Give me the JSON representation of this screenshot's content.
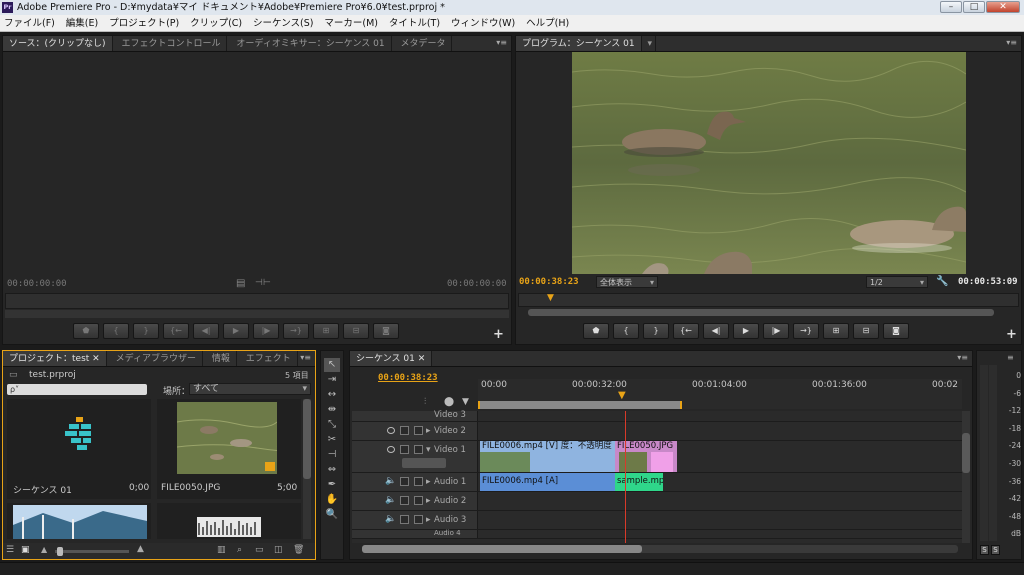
{
  "window": {
    "title": "Adobe Premiere Pro - D:¥mydata¥マイ ドキュメント¥Adobe¥Premiere Pro¥6.0¥test.prproj *",
    "app_badge": "Pr"
  },
  "menu": [
    "ファイル(F)",
    "編集(E)",
    "プロジェクト(P)",
    "クリップ(C)",
    "シーケンス(S)",
    "マーカー(M)",
    "タイトル(T)",
    "ウィンドウ(W)",
    "ヘルプ(H)"
  ],
  "source_panel": {
    "tabs": [
      "ソース：(クリップなし)",
      "エフェクトコントロール",
      "オーディオミキサー：シーケンス 01",
      "メタデータ"
    ],
    "tc_in": "00:00:00:00",
    "tc_out": "00:00:00:00"
  },
  "program_panel": {
    "tab": "プログラム：シーケンス 01",
    "tc_current": "00:00:38:23",
    "fit": "全体表示",
    "resolution": "1/2",
    "tc_duration": "00:00:53:09"
  },
  "project_panel": {
    "tabs": [
      "プロジェクト：test",
      "メディアブラウザー",
      "情報",
      "エフェクト"
    ],
    "project_file": "test.prproj",
    "item_count": "5 項目",
    "search_placeholder": "ρ˅",
    "location_label": "場所：",
    "location_value": "すべて",
    "items": [
      {
        "name": "シーケンス 01",
        "duration": "0;00"
      },
      {
        "name": "FILE0050.JPG",
        "duration": "5;00"
      }
    ]
  },
  "timeline": {
    "tab": "シーケンス 01",
    "tc_current": "00:00:38:23",
    "ruler": [
      "00:00",
      "00:00:32:00",
      "00:01:04:00",
      "00:01:36:00",
      "00:02"
    ],
    "tracks": {
      "video": [
        "Video 3",
        "Video 2",
        "Video 1"
      ],
      "audio": [
        "Audio 1",
        "Audio 2",
        "Audio 3",
        "Audio 4"
      ]
    },
    "clips": {
      "v1_a": "FILE0006.mp4 [V] 度：不透明度",
      "v1_b": "FILE0050.JPG",
      "a1_a": "FILE0006.mp4 [A]",
      "a1_b": "sample.mp"
    }
  },
  "audio_meter": {
    "scale": [
      "0",
      "-6",
      "-12",
      "-18",
      "-24",
      "-30",
      "-36",
      "-42",
      "-48",
      "dB"
    ],
    "solo_left": "S",
    "solo_right": "S"
  },
  "colors": {
    "accent": "#e8a317",
    "video_clip": "#8fb4e0",
    "image_clip": "#c888c8",
    "audio_clip": "#5b8ed6",
    "audio_clip2": "#2fd68a",
    "playhead": "#d83a2a"
  }
}
